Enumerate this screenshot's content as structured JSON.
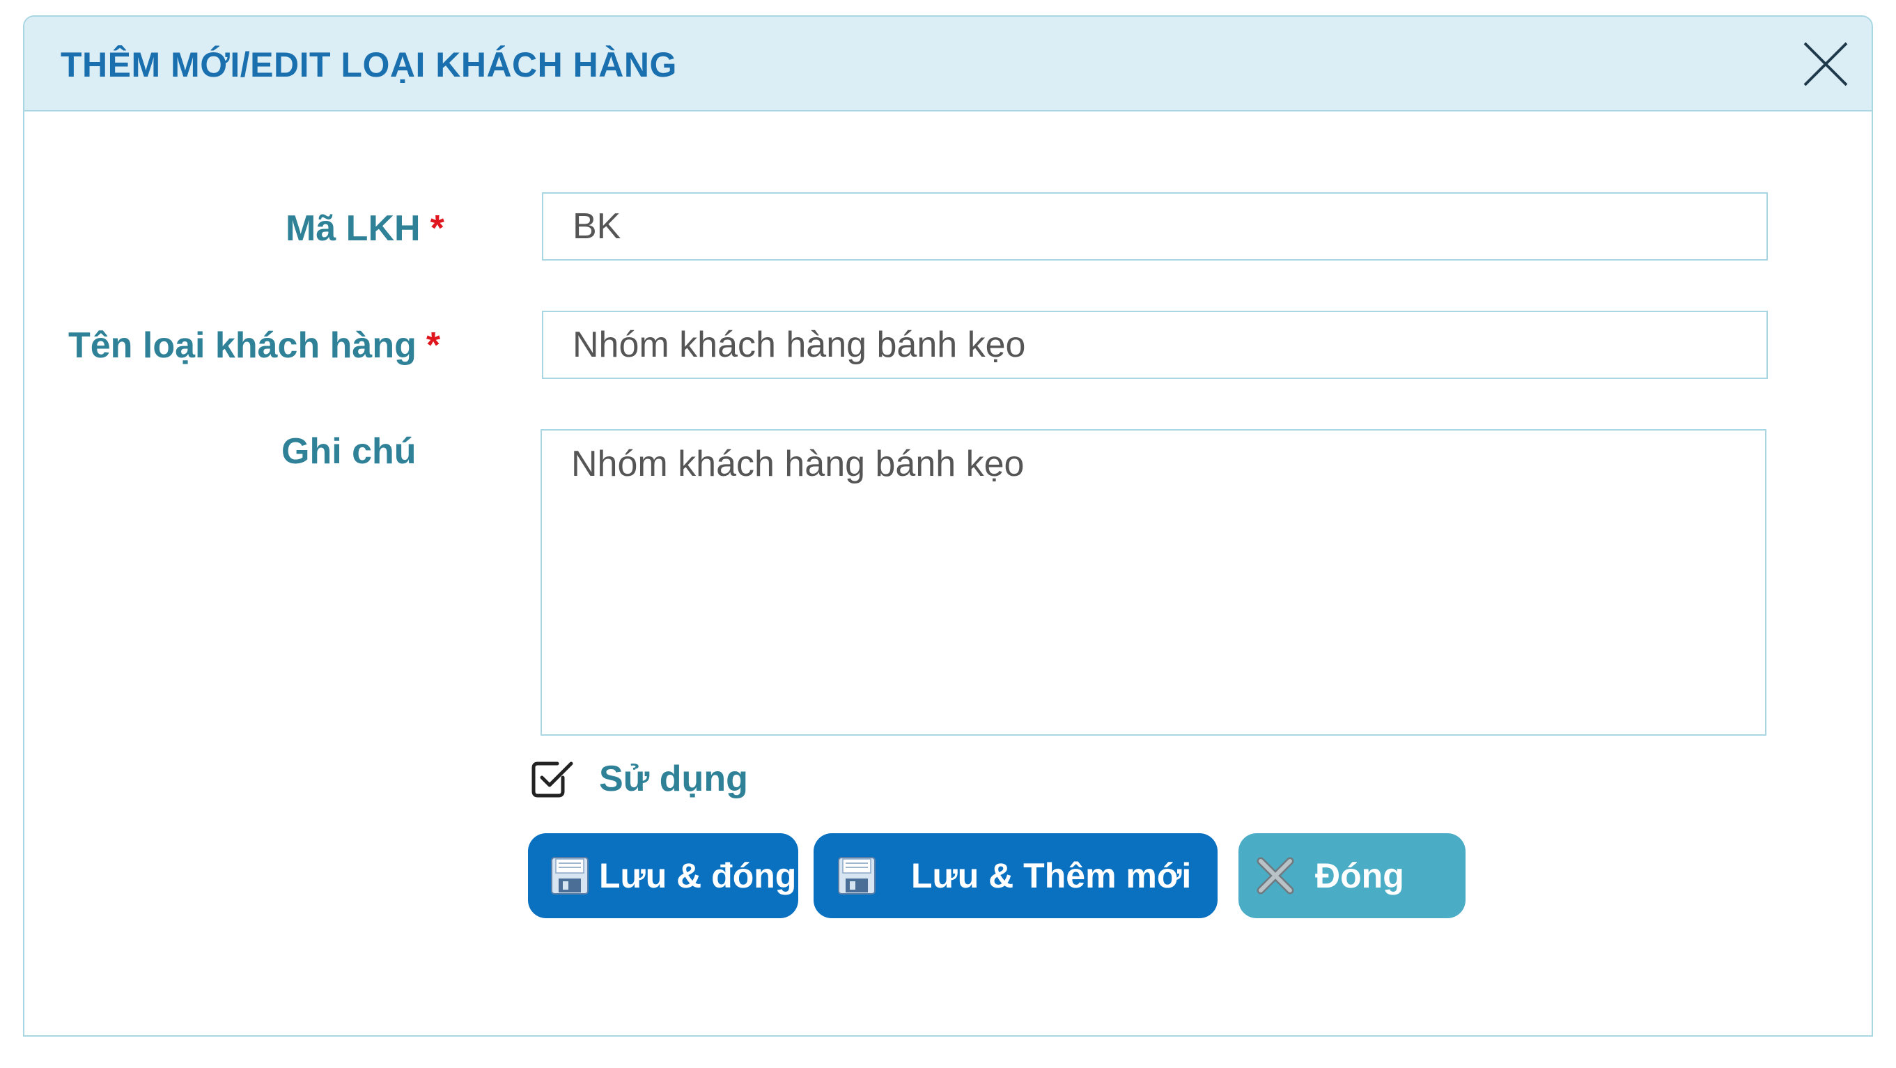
{
  "dialog": {
    "title": "THÊM MỚI/EDIT LOẠI KHÁCH HÀNG",
    "close_icon": "close-icon"
  },
  "form": {
    "code": {
      "label": "Mã LKH",
      "required_mark": "*",
      "value": "BK"
    },
    "name": {
      "label": "Tên loại khách hàng",
      "required_mark": "*",
      "value": "Nhóm khách hàng bánh kẹo"
    },
    "note": {
      "label": "Ghi chú",
      "value": "Nhóm khách hàng bánh kẹo"
    },
    "active": {
      "label": "Sử dụng",
      "checked": true
    }
  },
  "buttons": {
    "save_close": {
      "label": "Lưu & đóng",
      "icon": "floppy-disk-icon"
    },
    "save_new": {
      "label": "Lưu & Thêm mới",
      "icon": "floppy-disk-icon"
    },
    "close": {
      "label": "Đóng",
      "icon": "x-icon"
    }
  },
  "colors": {
    "header_bg": "#dbeef5",
    "title": "#1a6fae",
    "label": "#2e8196",
    "required": "#e0161f",
    "primary_button": "#0a70c0",
    "close_button": "#4bacc6",
    "border": "#a9d6e3"
  }
}
